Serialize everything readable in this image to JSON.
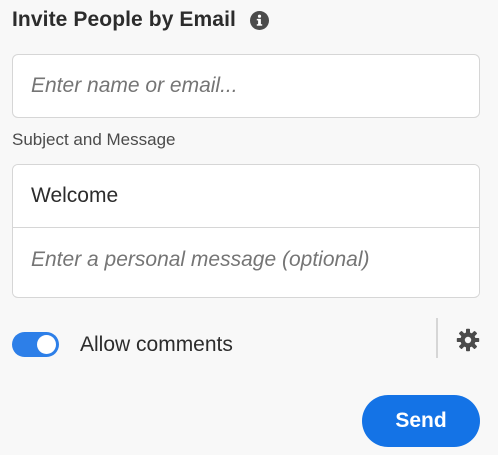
{
  "header": {
    "title": "Invite People by Email",
    "info_icon": "info-icon"
  },
  "recipients": {
    "placeholder": "Enter name or email...",
    "value": ""
  },
  "message_section": {
    "label": "Subject and Message",
    "subject_value": "Welcome",
    "message_placeholder": "Enter a personal message (optional)",
    "message_value": ""
  },
  "options": {
    "allow_comments_label": "Allow comments",
    "allow_comments_enabled": true,
    "settings_icon": "gear-icon"
  },
  "actions": {
    "send_label": "Send"
  },
  "colors": {
    "accent": "#1473e6",
    "toggle_on": "#2d7fe8",
    "text": "#2c2c2c",
    "border": "#d6d6d6",
    "background": "#f8f8f8"
  }
}
